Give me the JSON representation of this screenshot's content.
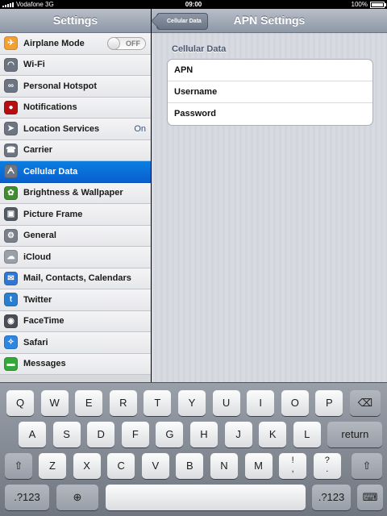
{
  "status_bar": {
    "carrier": "Vodafone 3G",
    "time": "09:00",
    "battery": "100%"
  },
  "master": {
    "title": "Settings",
    "items": [
      {
        "label": "Airplane Mode",
        "icon": "airplane-icon",
        "color": "#f2a031",
        "glyph": "✈",
        "toggle": "OFF"
      },
      {
        "label": "Wi-Fi",
        "icon": "wifi-icon",
        "color": "#6d7582",
        "glyph": "◠"
      },
      {
        "label": "Personal Hotspot",
        "icon": "hotspot-icon",
        "color": "#6d7582",
        "glyph": "∞"
      },
      {
        "label": "Notifications",
        "icon": "notifications-icon",
        "color": "#b50f12",
        "glyph": "●"
      },
      {
        "label": "Location Services",
        "icon": "location-icon",
        "color": "#6d7582",
        "glyph": "➤",
        "value": "On"
      },
      {
        "label": "Carrier",
        "icon": "carrier-icon",
        "color": "#6d7582",
        "glyph": "☎"
      },
      {
        "label": "Cellular Data",
        "icon": "cellular-data-icon",
        "color": "#6d7582",
        "glyph": "ᗅ",
        "selected": true
      },
      {
        "label": "Brightness & Wallpaper",
        "icon": "brightness-icon",
        "color": "#3f8d2f",
        "glyph": "✿"
      },
      {
        "label": "Picture Frame",
        "icon": "picture-frame-icon",
        "color": "#555b63",
        "glyph": "▣"
      },
      {
        "label": "General",
        "icon": "gear-icon",
        "color": "#7a8089",
        "glyph": "⚙"
      },
      {
        "label": "iCloud",
        "icon": "icloud-icon",
        "color": "#9aa0a8",
        "glyph": "☁"
      },
      {
        "label": "Mail, Contacts, Calendars",
        "icon": "mail-icon",
        "color": "#2f77d2",
        "glyph": "✉"
      },
      {
        "label": "Twitter",
        "icon": "twitter-icon",
        "color": "#2a7ed0",
        "glyph": "t"
      },
      {
        "label": "FaceTime",
        "icon": "facetime-icon",
        "color": "#4a4f57",
        "glyph": "◉"
      },
      {
        "label": "Safari",
        "icon": "safari-icon",
        "color": "#2e86e0",
        "glyph": "✧"
      },
      {
        "label": "Messages",
        "icon": "messages-icon",
        "color": "#35a83a",
        "glyph": "▬"
      }
    ]
  },
  "detail": {
    "back_button": "Cellular Data",
    "title": "APN Settings",
    "section_header": "Cellular Data",
    "fields": [
      {
        "label": "APN"
      },
      {
        "label": "Username"
      },
      {
        "label": "Password"
      }
    ]
  },
  "keyboard": {
    "row1": [
      "Q",
      "W",
      "E",
      "R",
      "T",
      "Y",
      "U",
      "I",
      "O",
      "P"
    ],
    "row2": [
      "A",
      "S",
      "D",
      "F",
      "G",
      "H",
      "J",
      "K",
      "L"
    ],
    "row3": [
      "Z",
      "X",
      "C",
      "V",
      "B",
      "N",
      "M"
    ],
    "return_label": "return",
    "exclaim_top": "!",
    "exclaim_bottom": ",",
    "question_top": "?",
    "question_bottom": ".",
    "numbers_label": ".?123"
  }
}
